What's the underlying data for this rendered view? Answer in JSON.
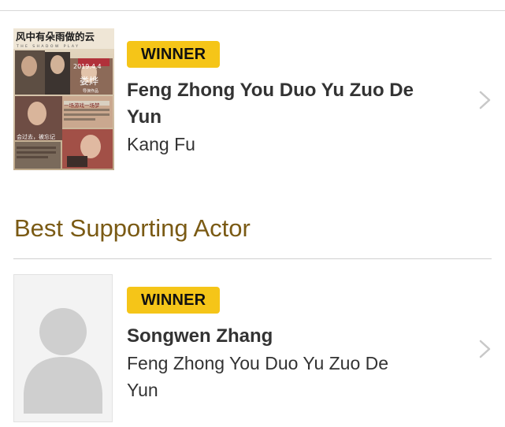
{
  "awards": [
    {
      "badge": "WINNER",
      "title_line1": "Feng Zhong You Duo Yu Zuo De",
      "title_line2": "Yun",
      "subtitle_line1": "Kang Fu",
      "poster_icon": "movie-poster-image"
    },
    {
      "section_heading": "Best Supporting Actor",
      "badge": "WINNER",
      "title_line1": "Songwen Zhang",
      "subtitle_line1": "Feng Zhong You Duo Yu Zuo De",
      "subtitle_line2": "Yun",
      "avatar_icon": "person-placeholder-icon"
    }
  ],
  "poster": {
    "title_cn": "风中有朵雨做的云",
    "subtitle_en": "THE SHADOW PLAY",
    "date": "2019.4.4",
    "director_cn": "娄烨",
    "director_note_cn": "导演作品",
    "tagline_cn": "一场游戏一场梦",
    "tagline2_cn": "会过去，被忘记"
  },
  "colors": {
    "badge_bg": "#f5c518",
    "heading": "#7a5a14",
    "text": "#333333",
    "divider": "#d0d0d0",
    "chevron": "#c8c8c8"
  },
  "icons": {
    "chevron": "chevron-right-icon"
  }
}
